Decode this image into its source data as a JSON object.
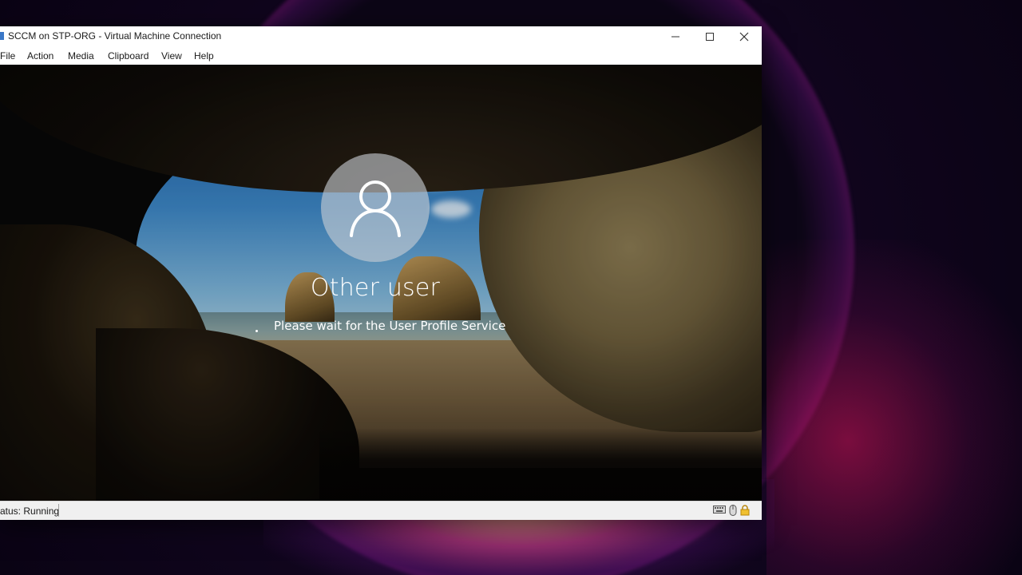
{
  "window": {
    "title": "SCCM on STP-ORG - Virtual Machine Connection"
  },
  "menu": {
    "items": [
      {
        "label": "File"
      },
      {
        "label": "Action"
      },
      {
        "label": "Media"
      },
      {
        "label": "Clipboard"
      },
      {
        "label": "View"
      },
      {
        "label": "Help"
      }
    ]
  },
  "guest": {
    "username": "Other user",
    "status_message": "Please wait for the User Profile Service",
    "avatar_icon": "user-icon"
  },
  "statusbar": {
    "status_text": "atus: Running",
    "icons": [
      "keyboard-icon",
      "mouse-icon",
      "lock-icon"
    ]
  },
  "colors": {
    "titlebar_bg": "#ffffff",
    "statusbar_bg": "#f0f0f0",
    "desktop_accent": "#c81e6a"
  }
}
